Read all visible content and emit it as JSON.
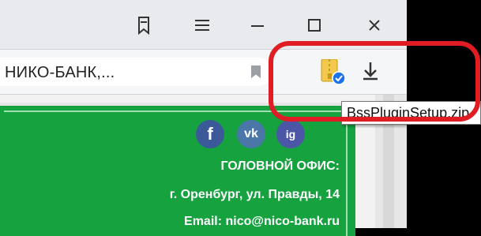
{
  "browser": {
    "address_text": "НИКО-БАНК,...",
    "tooltip_text": "BssPluginSetup.zip"
  },
  "icons": {
    "tab_search": "tab-search-icon",
    "menu": "menu-icon",
    "minimize": "minimize-icon",
    "maximize": "maximize-icon",
    "close": "close-icon",
    "bookmark": "bookmark-icon",
    "extension": "zip-extension-icon",
    "download": "download-icon"
  },
  "site": {
    "social": [
      "f",
      "vk",
      "ig"
    ],
    "head_office_label": "ГОЛОВНОЙ ОФИС:",
    "address_line": "г. Оренбург, ул. Правды, 14",
    "email_line": "Email: nico@nico-bank.ru"
  },
  "colors": {
    "highlight": "#e01d24",
    "site_green": "#15a23f",
    "social_blue": "#3b4fa3"
  }
}
